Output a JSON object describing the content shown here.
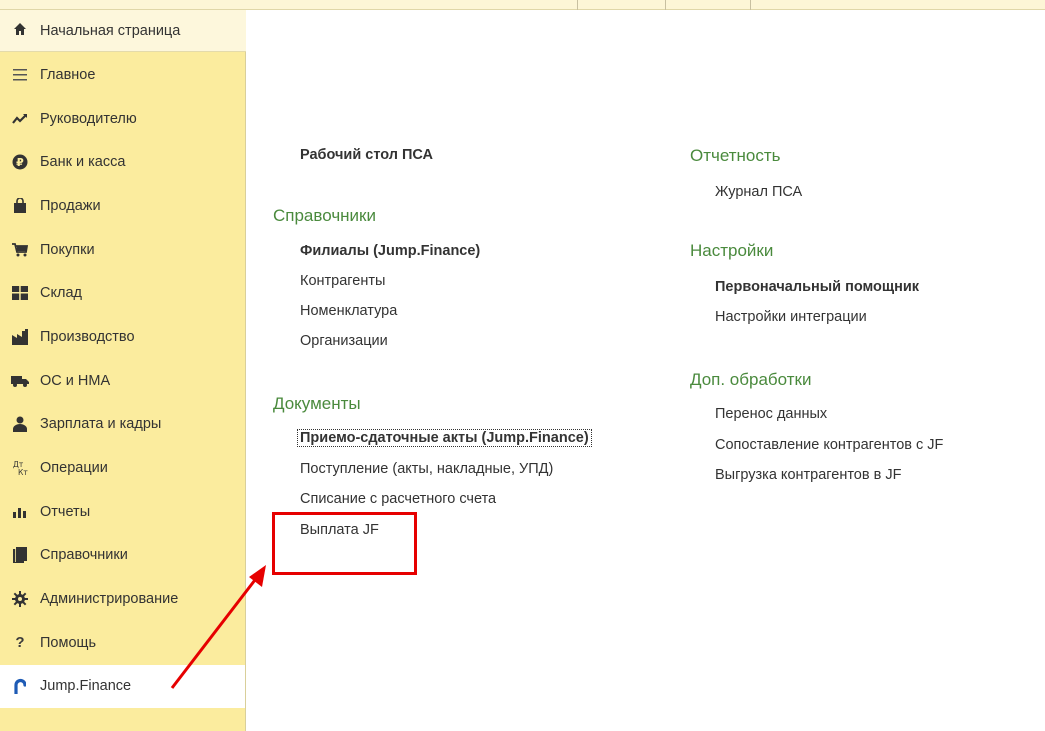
{
  "sidebar": {
    "home": {
      "label": "Начальная страница",
      "icon": "home-icon"
    },
    "items": [
      {
        "label": "Главное",
        "icon": "menu-lines-icon"
      },
      {
        "label": "Руководителю",
        "icon": "trend-up-icon"
      },
      {
        "label": "Банк и касса",
        "icon": "ruble-icon"
      },
      {
        "label": "Продажи",
        "icon": "shopping-bag-icon"
      },
      {
        "label": "Покупки",
        "icon": "cart-icon"
      },
      {
        "label": "Склад",
        "icon": "warehouse-icon"
      },
      {
        "label": "Производство",
        "icon": "factory-icon"
      },
      {
        "label": "ОС и НМА",
        "icon": "truck-icon"
      },
      {
        "label": "Зарплата и кадры",
        "icon": "person-icon"
      },
      {
        "label": "Операции",
        "icon": "debit-credit-icon",
        "icon_text": "Дт\nКт"
      },
      {
        "label": "Отчеты",
        "icon": "bar-chart-icon"
      },
      {
        "label": "Справочники",
        "icon": "books-icon"
      },
      {
        "label": "Администрирование",
        "icon": "gear-icon"
      },
      {
        "label": "Помощь",
        "icon": "help-icon"
      },
      {
        "label": "Jump.Finance",
        "icon": "jump-finance-icon",
        "active": true
      }
    ]
  },
  "main": {
    "desk_link": "Рабочий стол ПСА",
    "references": {
      "title": "Справочники",
      "links": [
        "Филиалы (Jump.Finance)",
        "Контрагенты",
        "Номенклатура",
        "Организации"
      ]
    },
    "documents": {
      "title": "Документы",
      "links": [
        "Приемо-сдаточные акты (Jump.Finance)",
        "Поступление (акты, накладные, УПД)",
        "Списание с расчетного счета",
        "Выплата JF"
      ]
    },
    "reporting": {
      "title": "Отчетность",
      "links": [
        "Журнал ПСА"
      ]
    },
    "settings": {
      "title": "Настройки",
      "links": [
        "Первоначальный помощник",
        "Настройки интеграции"
      ]
    },
    "processing": {
      "title": "Доп. обработки",
      "links": [
        "Перенос данных",
        "Сопоставление контрагентов с JF",
        "Выгрузка контрагентов в JF"
      ]
    }
  },
  "colors": {
    "sidebar_bg": "#fbec9e",
    "section_title": "#4a8a3d",
    "annotation": "#e60000",
    "jump_icon": "#1e5bb5"
  }
}
